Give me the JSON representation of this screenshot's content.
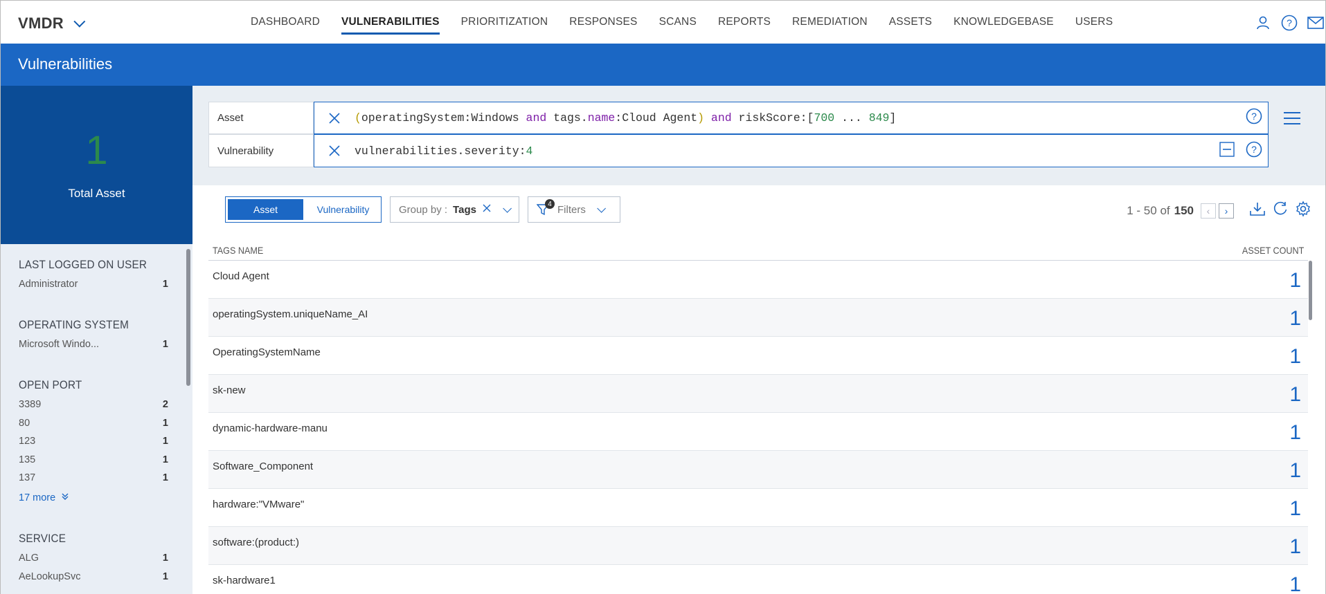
{
  "app": {
    "name": "VMDR"
  },
  "nav": [
    {
      "label": "DASHBOARD",
      "active": false
    },
    {
      "label": "VULNERABILITIES",
      "active": true
    },
    {
      "label": "PRIORITIZATION",
      "active": false
    },
    {
      "label": "RESPONSES",
      "active": false
    },
    {
      "label": "SCANS",
      "active": false
    },
    {
      "label": "REPORTS",
      "active": false
    },
    {
      "label": "REMEDIATION",
      "active": false
    },
    {
      "label": "ASSETS",
      "active": false
    },
    {
      "label": "KNOWLEDGEBASE",
      "active": false
    },
    {
      "label": "USERS",
      "active": false
    }
  ],
  "top_icons": [
    "user-icon",
    "help-icon",
    "mail-icon"
  ],
  "page": {
    "title": "Vulnerabilities"
  },
  "summary": {
    "count": "1",
    "label": "Total Asset"
  },
  "sidebar": {
    "groups": [
      {
        "title": "LAST LOGGED ON USER",
        "items": [
          {
            "label": "Administrator",
            "count": "1"
          }
        ]
      },
      {
        "title": "OPERATING SYSTEM",
        "items": [
          {
            "label": "Microsoft Windo...",
            "count": "1"
          }
        ]
      },
      {
        "title": "OPEN PORT",
        "items": [
          {
            "label": "3389",
            "count": "2"
          },
          {
            "label": "80",
            "count": "1"
          },
          {
            "label": "123",
            "count": "1"
          },
          {
            "label": "135",
            "count": "1"
          },
          {
            "label": "137",
            "count": "1"
          }
        ],
        "more": "17 more"
      },
      {
        "title": "SERVICE",
        "items": [
          {
            "label": "ALG",
            "count": "1"
          },
          {
            "label": "AeLookupSvc",
            "count": "1"
          }
        ]
      }
    ]
  },
  "query": {
    "asset_label": "Asset",
    "asset_tokens": {
      "open": "(",
      "p1": "operatingSystem:Windows ",
      "and1": "and",
      "p2": " tags.",
      "name": "name",
      "p3": ":Cloud Agent",
      "close": ")",
      "and2": " and",
      "p4": " riskScore:[",
      "n1": "700",
      "p5": " ... ",
      "n2": "849",
      "p6": "]"
    },
    "vuln_label": "Vulnerability",
    "vuln_tokens": {
      "p1": "vulnerabilities.severity:",
      "n1": "4"
    }
  },
  "toolbar": {
    "toggle_asset": "Asset",
    "toggle_vuln": "Vulnerability",
    "groupby_label": "Group by :",
    "groupby_value": "Tags",
    "filters_label": "Filters",
    "filters_badge": "4",
    "pager_range": "1 - 50 of",
    "pager_total": "150"
  },
  "table": {
    "col_name": "TAGS NAME",
    "col_count": "ASSET COUNT",
    "rows": [
      {
        "name": "Cloud Agent",
        "count": "1"
      },
      {
        "name": "operatingSystem.uniqueName_AI",
        "count": "1"
      },
      {
        "name": "OperatingSystemName",
        "count": "1"
      },
      {
        "name": "sk-new",
        "count": "1"
      },
      {
        "name": "dynamic-hardware-manu",
        "count": "1"
      },
      {
        "name": "Software_Component",
        "count": "1"
      },
      {
        "name": "hardware:\"VMware\"",
        "count": "1"
      },
      {
        "name": "software:(product:)",
        "count": "1"
      },
      {
        "name": "sk-hardware1",
        "count": "1"
      }
    ]
  },
  "colors": {
    "primary": "#1b67c4",
    "dark": "#0b4c96",
    "keyword": "#7e1fa8",
    "number": "#2c8a4c"
  }
}
